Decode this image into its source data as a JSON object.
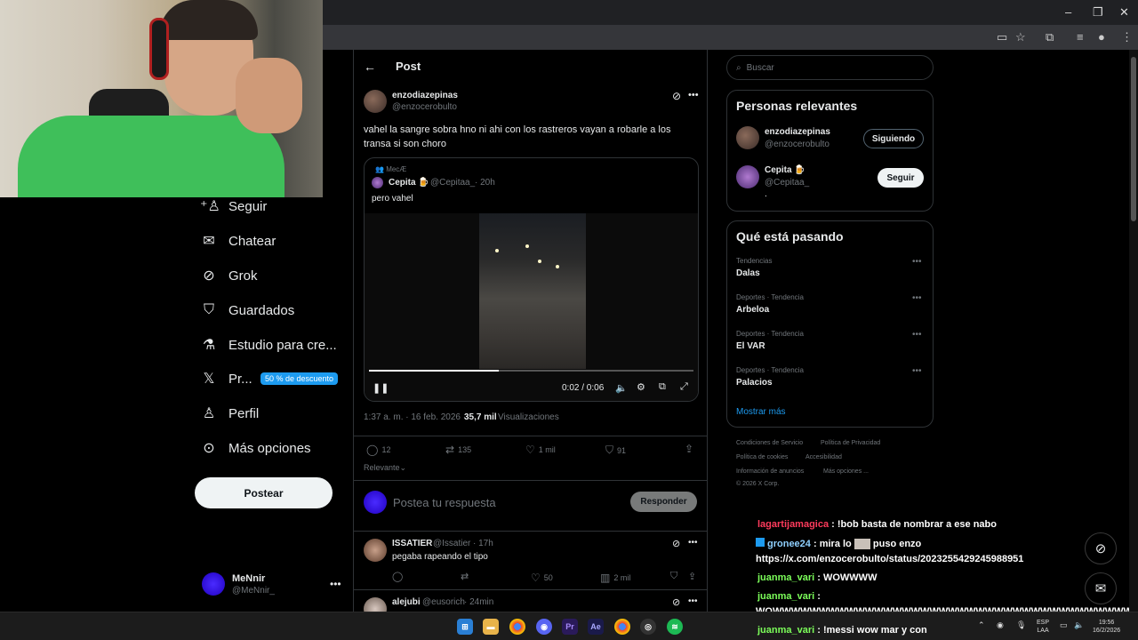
{
  "browser": {
    "window_controls": [
      "–",
      "❐",
      "✕"
    ]
  },
  "nav": {
    "items": [
      {
        "label": "Seguir",
        "icon": "add-user-icon"
      },
      {
        "label": "Chatear",
        "icon": "mail-icon"
      },
      {
        "label": "Grok",
        "icon": "grok-icon"
      },
      {
        "label": "Guardados",
        "icon": "bookmark-icon"
      },
      {
        "label": "Estudio para cre...",
        "icon": "flask-icon"
      },
      {
        "label": "Pr...",
        "icon": "x-logo-icon"
      },
      {
        "label": "Perfil",
        "icon": "person-icon"
      },
      {
        "label": "Más opciones",
        "icon": "more-circle-icon"
      }
    ],
    "promo_badge": "50 % de descuento",
    "post_button": "Postear",
    "account": {
      "name": "MeNnir",
      "handle": "@MeNnir_"
    }
  },
  "post_page": {
    "back_icon": "←",
    "title": "Post",
    "author": {
      "name": "enzodiazepinas",
      "handle": "@enzocerobulto"
    },
    "text": "vahel la sangre sobra  hno ni ahi con los rastreros vayan a robarle a los transa si son choro",
    "quote": {
      "context": "MecÆ",
      "name": "Cepita 🍺",
      "handle": "@Cepitaa_",
      "time": "· 20h",
      "text": "pero vahel",
      "video": {
        "time": "0:02 / 0:06",
        "progress": 0.4
      }
    },
    "meta": {
      "timestamp": "1:37 a. m. · 16 feb. 2026 ·",
      "views": "35,7 mil",
      "views_label": "Visualizaciones"
    },
    "actions": {
      "replies": "12",
      "reposts": "135",
      "likes": "1 mil",
      "bookmarks": "91"
    },
    "sort": "Relevante",
    "reply_placeholder": "Postea tu respuesta",
    "reply_button": "Responder",
    "replies": [
      {
        "name": "ISSATIER",
        "handle": "@Issatier",
        "time": "· 17h",
        "text": "pegaba rapeando el tipo",
        "likes": "50",
        "views": "2 mil"
      },
      {
        "name": "alejubi",
        "handle": "@eusorich",
        "time": "· 24min"
      }
    ]
  },
  "sidebar": {
    "search_placeholder": "Buscar",
    "relevant": {
      "title": "Personas relevantes",
      "people": [
        {
          "name": "enzodiazepinas",
          "handle": "@enzocerobulto",
          "button": "Siguiendo"
        },
        {
          "name": "Cepita 🍺",
          "handle": "@Cepitaa_",
          "bio": ".",
          "button": "Seguir"
        }
      ]
    },
    "trends": {
      "title": "Qué está pasando",
      "items": [
        {
          "category": "Tendencias",
          "name": "Dalas"
        },
        {
          "category": "Deportes · Tendencia",
          "name": "Arbeloa"
        },
        {
          "category": "Deportes · Tendencia",
          "name": "El VAR"
        },
        {
          "category": "Deportes · Tendencia",
          "name": "Palacios"
        }
      ],
      "show_more": "Mostrar más"
    },
    "footer": [
      "Condiciones de Servicio",
      "Política de Privacidad",
      "Política de cookies",
      "Accesibilidad",
      "Información de anuncios",
      "Más opciones ...",
      "© 2026 X Corp."
    ]
  },
  "chat": [
    {
      "user": "lagartijamagica",
      "color": "#ff3b5c",
      "msg": " : !bob basta de nombrar a ese nabo"
    },
    {
      "user": "gronee24",
      "color": "#8fd0ff",
      "msg": " : mira lo",
      "msg2": " puso enzo"
    },
    {
      "user": "",
      "color": "#fff",
      "msg": "https://x.com/enzocerobulto/status/2023255429245988951"
    },
    {
      "user": "juanma_vari",
      "color": "#7cff5a",
      "msg": " : WOWWWW"
    },
    {
      "user": "juanma_vari",
      "color": "#7cff5a",
      "msg": " :"
    },
    {
      "user": "",
      "color": "#fff",
      "msg": "WOWWWWWWWWWWWWWWWWWWWWWWWWWWWWWWWWWWWWWWWW"
    },
    {
      "user": "juanma_vari",
      "color": "#7cff5a",
      "msg": " : !messi wow mar y con"
    }
  ],
  "taskbar": {
    "lang": "ESP",
    "lang2": "LAA",
    "time": "19:56",
    "date": "16/2/2026"
  },
  "colors": {
    "accent": "#1d9bf0",
    "background": "#000000",
    "border": "#2f3336"
  }
}
